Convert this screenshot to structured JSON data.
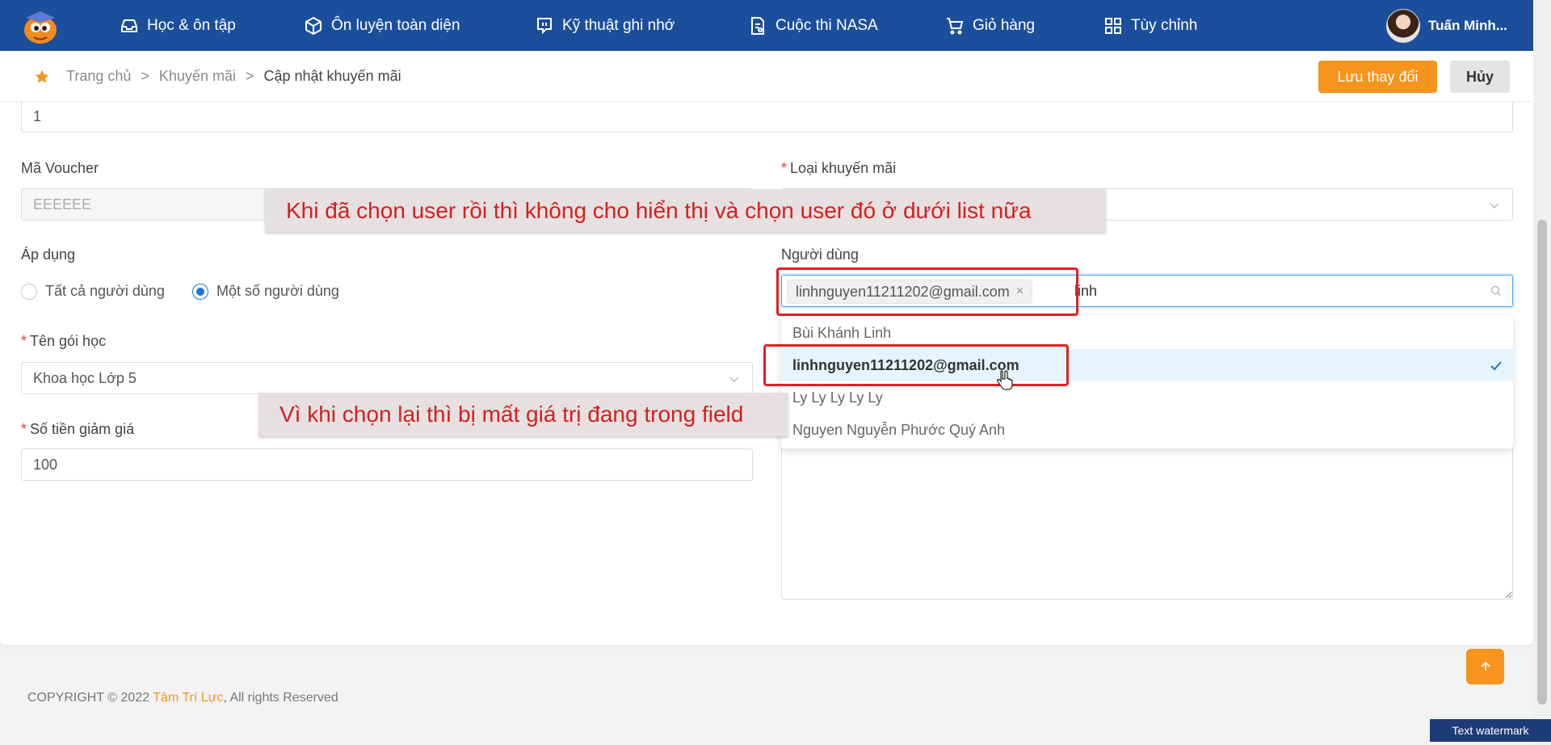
{
  "nav": {
    "items": [
      {
        "label": "Học & ôn tập",
        "icon": "inbox-icon"
      },
      {
        "label": "Ôn luyện toàn diện",
        "icon": "cube-icon"
      },
      {
        "label": "Kỹ thuật ghi nhớ",
        "icon": "chat-bubble-icon"
      },
      {
        "label": "Cuộc thi NASA",
        "icon": "document-icon"
      },
      {
        "label": "Giỏ hàng",
        "icon": "cart-icon"
      },
      {
        "label": "Tùy chỉnh",
        "icon": "grid-icon"
      }
    ],
    "user_name": "Tuấn Minh..."
  },
  "breadcrumb": {
    "home": "Trang chủ",
    "section": "Khuyến mãi",
    "current": "Cập nhật khuyến mãi",
    "separator": ">"
  },
  "actions": {
    "save_label": "Lưu thay đổi",
    "cancel_label": "Hủy"
  },
  "form": {
    "top_value": "1",
    "voucher_label": "Mã Voucher",
    "voucher_value": "EEEEEE",
    "promo_type_label": "Loại khuyến mãi",
    "apply_label": "Áp dụng",
    "apply_all": "Tất cả người dùng",
    "apply_some": "Một số người dùng",
    "users_label": "Người dùng",
    "selected_user": "linhnguyen11211202@gmail.com",
    "tag_remove": "×",
    "search_text": "linh",
    "course_label": "Tên gói học",
    "course_value": "Khoa học Lớp 5",
    "discount_label": "Số tiền giảm giá",
    "discount_value": "100"
  },
  "dropdown": {
    "options": [
      "Bùi Khánh Linh",
      "linhnguyen11211202@gmail.com",
      "Ly Ly Ly Ly Ly",
      "Nguyen Nguyễn Phước Quý Anh"
    ],
    "selected_index": 1
  },
  "annotations": {
    "note_top": "Khi đã chọn user rồi thì không cho hiển thị và chọn user đó ở dưới list nữa",
    "note_bottom": "Vì khi chọn lại thì bị mất giá trị đang trong field"
  },
  "footer": {
    "prefix": "COPYRIGHT © 2022 ",
    "brand": "Tâm Trí Lực",
    "suffix": ", All rights Reserved"
  },
  "watermark": "Text watermark",
  "colors": {
    "nav_bg": "#1c4f9b",
    "accent": "#f7941d",
    "annotation_red": "#e02020"
  }
}
